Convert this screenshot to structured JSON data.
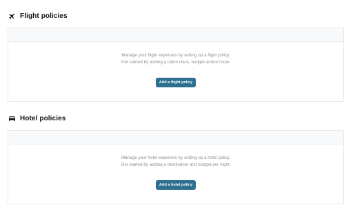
{
  "flight": {
    "title": "Flight policies",
    "icon": "airplane-icon",
    "description_line1": "Manage your flight expenses by setting up a flight policy.",
    "description_line2": "Get started by adding a cabin class, budget and/or route.",
    "button_label": "Add a flight policy"
  },
  "hotel": {
    "title": "Hotel policies",
    "icon": "bed-icon",
    "description_line1": "Manage your hotel expenses by setting up a hotel policy.",
    "description_line2": "Get started by adding a destination and budget per night.",
    "button_label": "Add a hotel policy"
  },
  "colors": {
    "button": "#2c6f8f",
    "card_border": "#e3e6ea",
    "muted_text": "#8a9099"
  }
}
